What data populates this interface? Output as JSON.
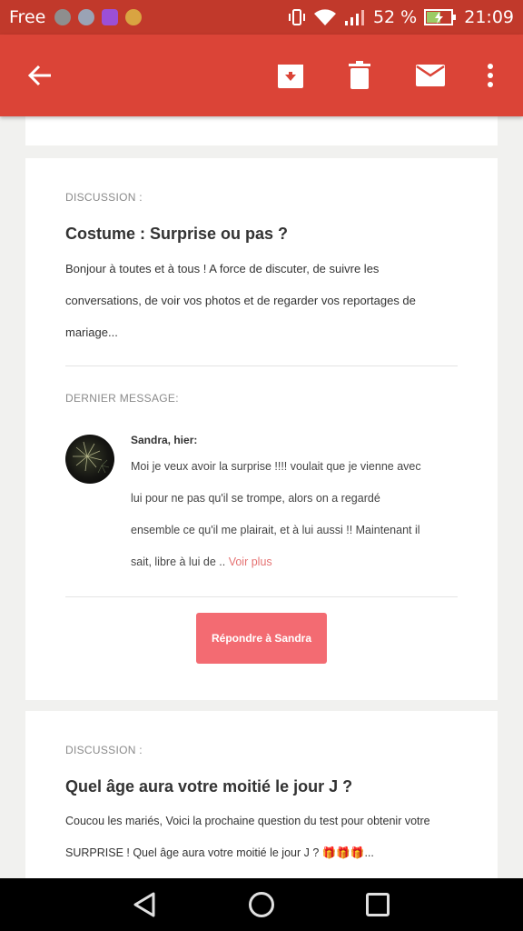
{
  "status_bar": {
    "carrier": "Free",
    "battery": "52 %",
    "time": "21:09",
    "notification_icons": [
      "app-notif-icon",
      "app-notif-icon",
      "gallery-notif-icon",
      "game-notif-icon"
    ]
  },
  "toolbar": {
    "icons": [
      "back-arrow-icon",
      "archive-icon",
      "delete-icon",
      "mail-icon",
      "more-vert-icon"
    ],
    "color": "#db4437"
  },
  "discussion1": {
    "kicker": "DISCUSSION :",
    "title": "Costume : Surprise ou pas ?",
    "excerpt_lines": [
      "Bonjour à toutes et à tous ! A force de discuter, de suivre les",
      "conversations, de voir vos photos et de regarder vos reportages de",
      "mariage..."
    ],
    "last_message_label": "DERNIER MESSAGE:",
    "author": "Sandra, hier:",
    "message_lines": [
      "Moi je veux avoir la surprise !!!! voulait que je vienne avec",
      "lui pour ne pas qu'il se trompe, alors on a regardé",
      "ensemble ce qu'il me plairait, et à lui aussi !! Maintenant il",
      "sait, libre à lui de .."
    ],
    "see_more": "Voir plus",
    "reply_label": "Répondre à Sandra",
    "accent": "#f36b72"
  },
  "discussion2": {
    "kicker": "DISCUSSION :",
    "title": "Quel âge aura votre moitié le jour J ?",
    "excerpt_lines": [
      "Coucou les mariés, Voici la prochaine question du test pour obtenir votre",
      "SURPRISE ! Quel âge aura votre moitié le jour J ? 🎁🎁🎁..."
    ]
  }
}
